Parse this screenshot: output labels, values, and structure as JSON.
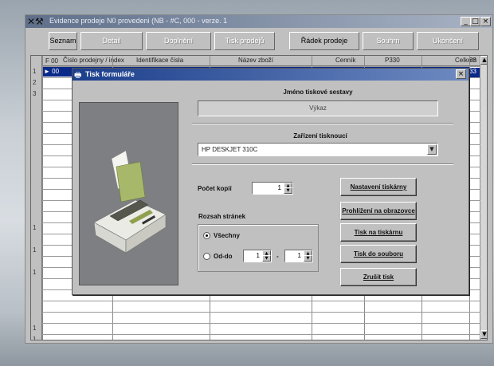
{
  "window": {
    "title": "Evidence prodeje N0 provedeni (NB - #C, 000 - verze. 1",
    "app_icon": "tools-icon",
    "controls": [
      "_",
      "□",
      "×"
    ]
  },
  "toolbar": {
    "tabs": [
      {
        "label": "Seznam",
        "enabled": true
      },
      {
        "label": "Detail",
        "enabled": false
      },
      {
        "label": "Doplnění",
        "enabled": false
      },
      {
        "label": "Tisk prodejů",
        "enabled": false
      },
      {
        "label": "Řádek prodeje",
        "enabled": true
      },
      {
        "label": "Souhrn",
        "enabled": false
      },
      {
        "label": "Ukončení",
        "enabled": false
      }
    ]
  },
  "grid": {
    "columns": [
      "Číslo prodejny / index",
      "Identifikace čísla",
      "Název zboží",
      "Cenník",
      "P330",
      "Celkem"
    ],
    "row_markers": [
      "1",
      "2",
      "3",
      "",
      "",
      "",
      "",
      "",
      "",
      "",
      "",
      "",
      "",
      "",
      "1",
      "",
      "1",
      "",
      "1",
      "",
      "",
      "",
      "",
      "1",
      "1"
    ],
    "first_row_prefix": "F 00",
    "selected_row_prefix": "► 00",
    "right_values": [
      "33",
      "33"
    ]
  },
  "dialog": {
    "title": "Tisk formuláře",
    "title_icon": "printer-icon",
    "close": "×",
    "printer_image_alt": "printer-illustration",
    "form_name_label": "Jméno tiskové sestavy",
    "form_name_value": "Výkaz",
    "device_label": "Zařízení tisknoucí",
    "device_value": "HP DESKJET 310C",
    "copies_label": "Počet kopií",
    "copies_value": "1",
    "range_label": "Rozsah stránek",
    "range_all": "Všechny",
    "range_from_to": "Od-do",
    "range_from": "1",
    "range_dash": "-",
    "range_to": "1",
    "buttons": {
      "setup": "Nastavení tiskárny",
      "preview": "Prohlížení na obrazovce",
      "print_matrix": "Tisk na tiskárnu",
      "print_file": "Tisk do souboru",
      "cancel": "Zrušit tisk"
    }
  }
}
